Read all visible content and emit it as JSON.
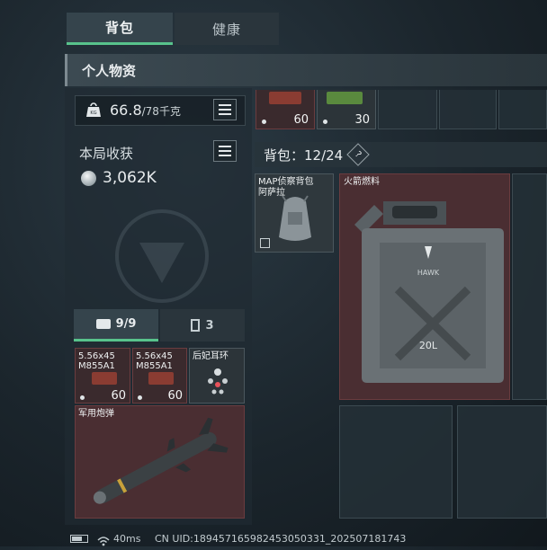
{
  "tabs": [
    {
      "label": "背包"
    },
    {
      "label": "健康"
    }
  ],
  "header": {
    "title": "个人物资"
  },
  "weight": {
    "current": "66.8",
    "max": "/78千克"
  },
  "loot": {
    "label": "本局收获",
    "value": "3,062K"
  },
  "top_items": [
    {
      "count": "60"
    },
    {
      "count": "30"
    }
  ],
  "backpack": {
    "label": "背包：12/24",
    "help": "?"
  },
  "backpack_item": {
    "name_line1": "MAP侦察背包",
    "name_line2": "阿萨拉"
  },
  "fuel_item": {
    "name": "火箭燃料",
    "logo_text": "HAWK",
    "capacity": "20L"
  },
  "subtabs": [
    {
      "count": "9/9"
    },
    {
      "count": "3"
    }
  ],
  "ammo_items": [
    {
      "line1": "5.56x45",
      "line2": "M855A1",
      "count": "60"
    },
    {
      "line1": "5.56x45",
      "line2": "M855A1",
      "count": "60"
    }
  ],
  "earring": {
    "name": "后妃耳环"
  },
  "missile": {
    "name": "军用炮弹"
  },
  "status_bar": {
    "ping": "40ms",
    "uid": "CN UID:18945716598245305033​1_202507181743"
  },
  "colors": {
    "accent": "#58c38c",
    "item_red": "#6a3c3f"
  }
}
